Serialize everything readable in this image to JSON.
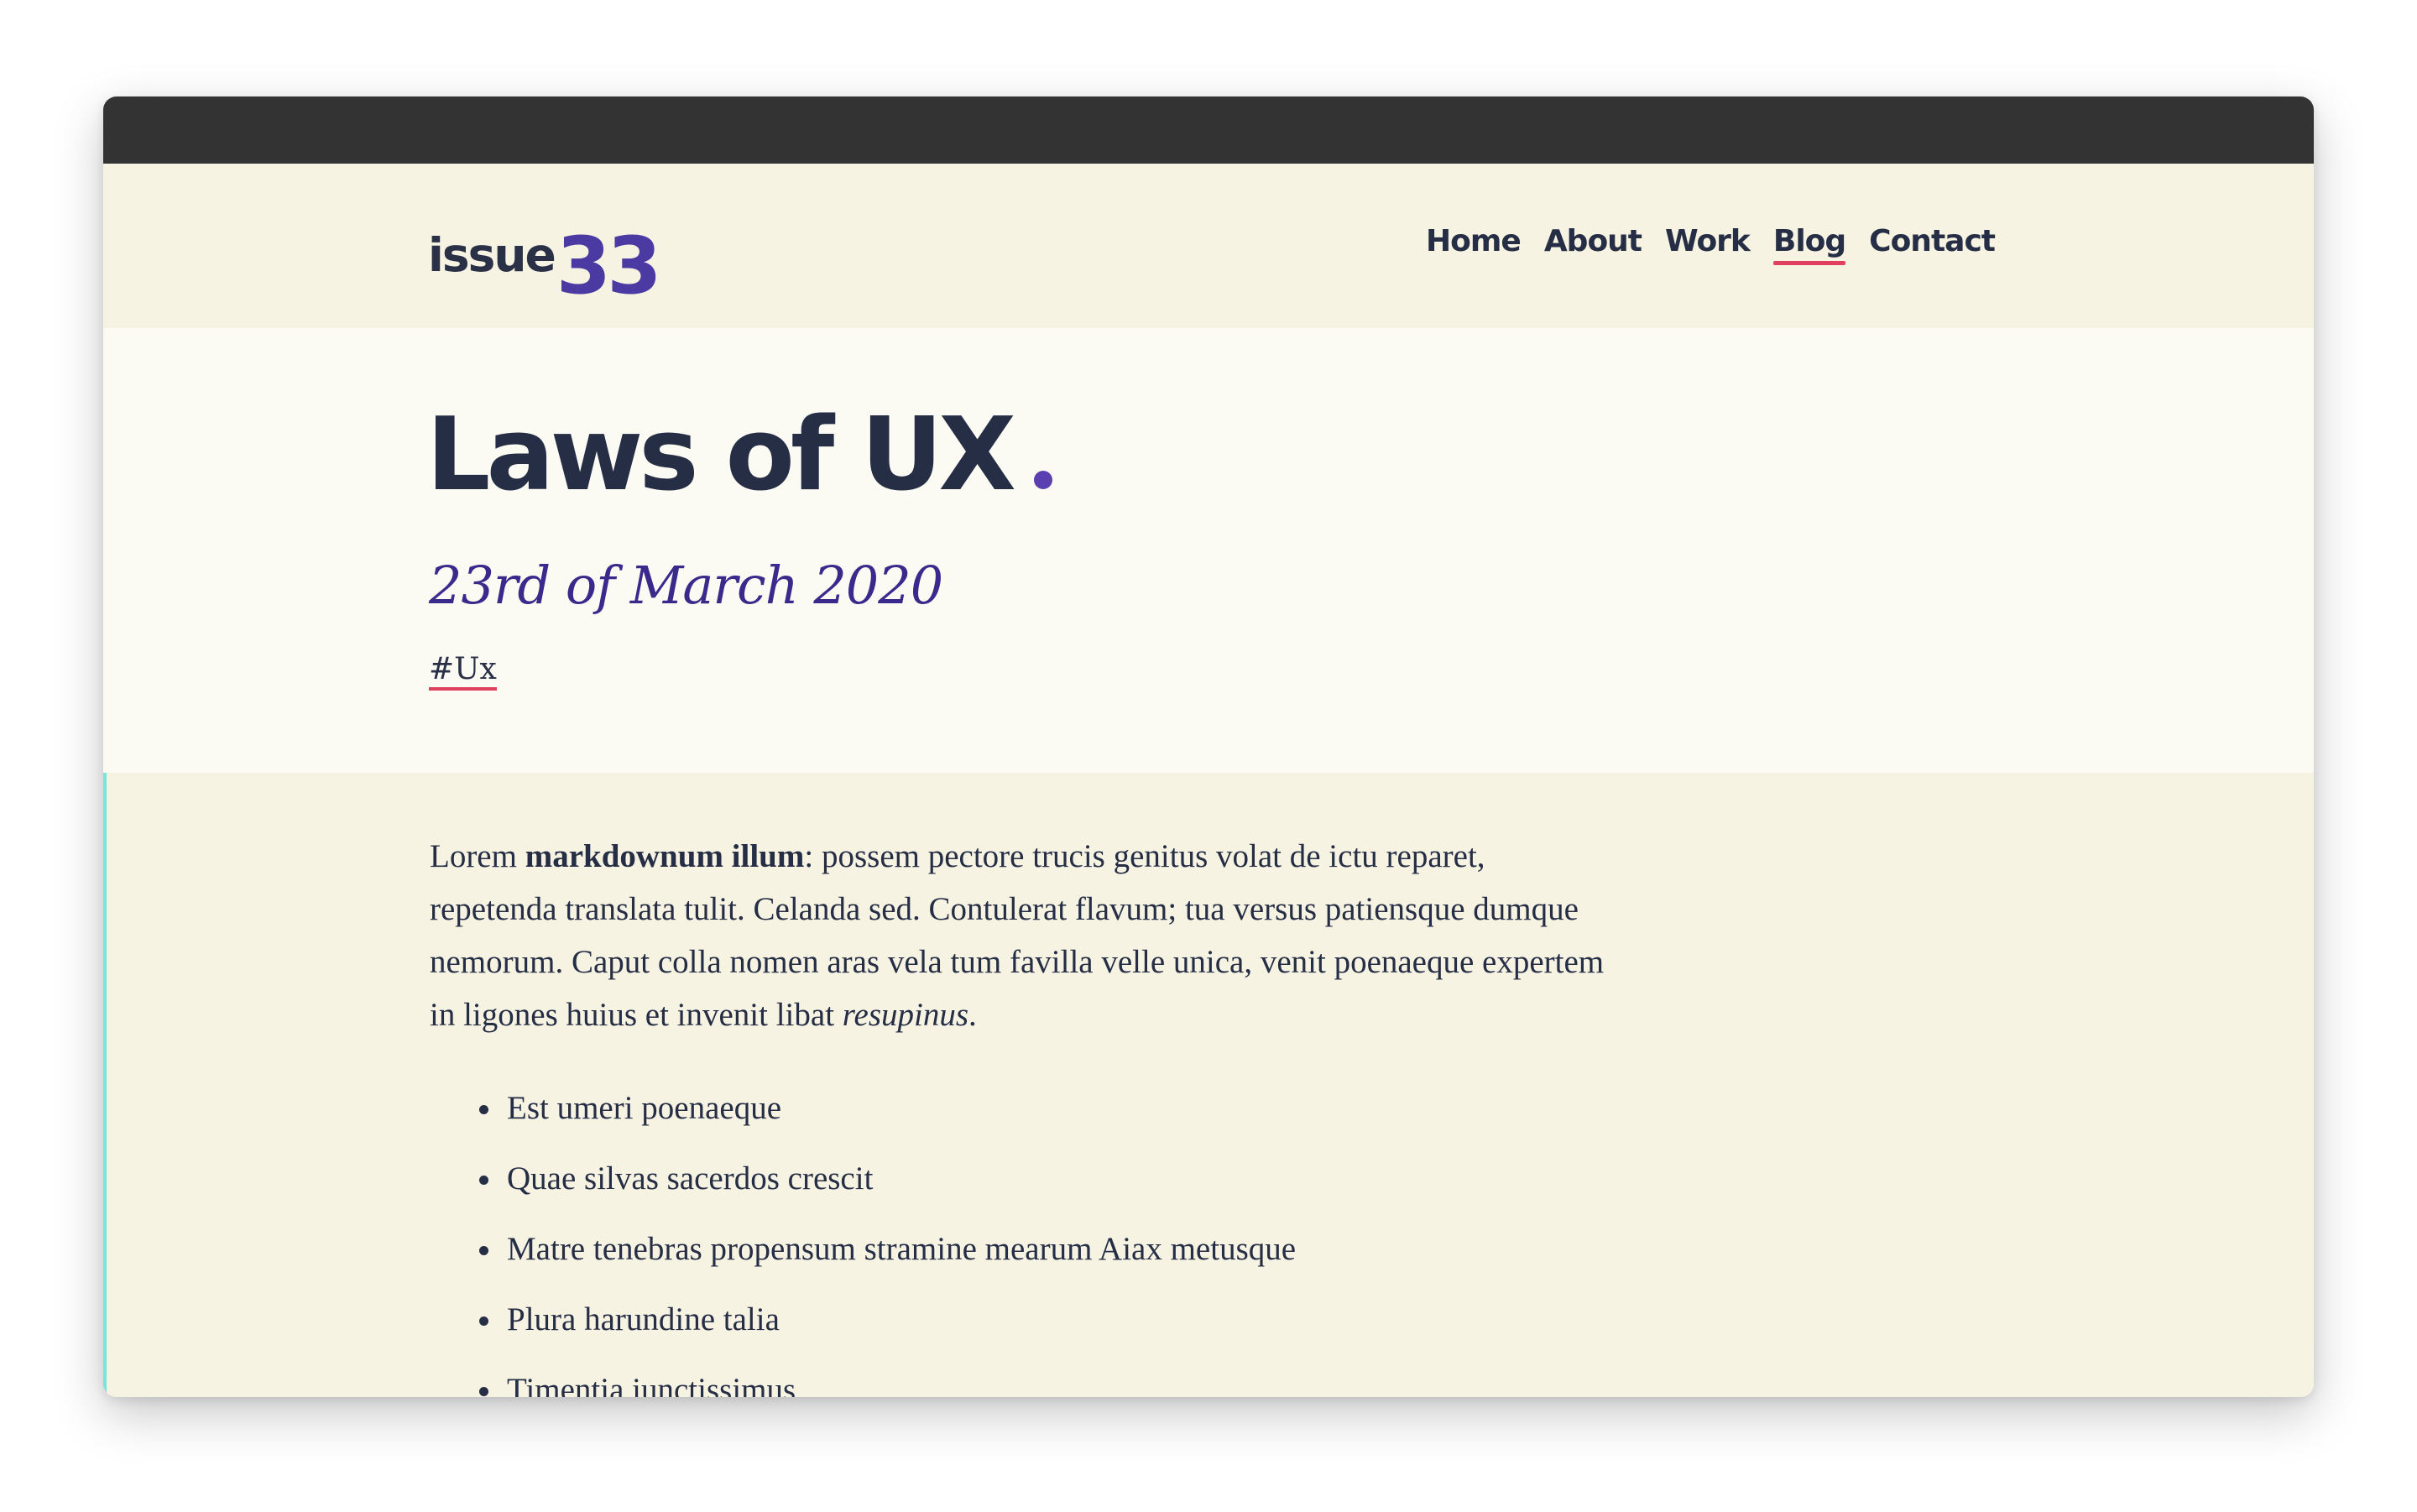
{
  "header": {
    "logo": {
      "word": "issue",
      "number": "33"
    },
    "nav": [
      {
        "label": "Home",
        "active": false
      },
      {
        "label": "About",
        "active": false
      },
      {
        "label": "Work",
        "active": false
      },
      {
        "label": "Blog",
        "active": true
      },
      {
        "label": "Contact",
        "active": false
      }
    ]
  },
  "post": {
    "title": "Laws of UX",
    "date": "23rd of March 2020",
    "tag": "#Ux"
  },
  "body": {
    "intro": {
      "lead": "Lorem ",
      "bold": "markdownum illum",
      "text": ": possem pectore trucis genitus volat de ictu reparet, repetenda translata tulit. Celanda sed. Contulerat flavum; tua versus patiensque dumque nemorum. Caput colla nomen aras vela tum favilla velle unica, venit poenaeque expertem in ligones huius et invenit libat ",
      "italic": "resupinus",
      "end": "."
    },
    "list": [
      "Est umeri poenaeque",
      "Quae silvas sacerdos crescit",
      "Matre tenebras propensum stramine mearum Aiax metusque",
      "Plura harundine talia",
      "Timentia iunctissimus"
    ]
  },
  "colors": {
    "accent_purple": "#4c3aa3",
    "text_navy": "#252e45",
    "underline_red": "#e0405e",
    "header_bg": "#f7f3e3",
    "hero_bg": "#fbfaf3",
    "window_bar": "#333333",
    "content_border": "#7be3d7"
  }
}
